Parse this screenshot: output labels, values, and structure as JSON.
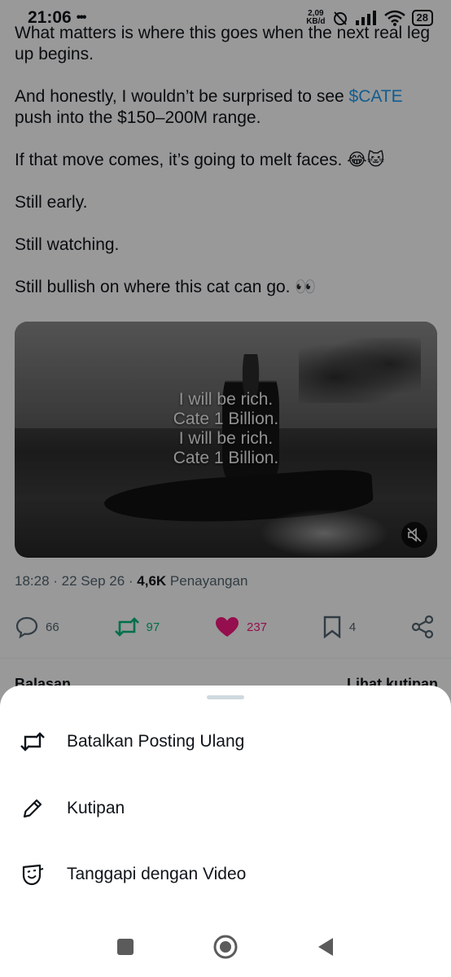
{
  "status_bar": {
    "time": "21:06",
    "notification_dots": "•••",
    "net_speed_value": "2,09",
    "net_speed_unit": "KB/d",
    "battery": "28"
  },
  "tweet": {
    "paragraphs": {
      "p1": "What matters is where this goes when the next real leg up begins.",
      "p2_before": "And honestly, I wouldn’t be surprised to see ",
      "p2_cashtag": "$CATE",
      "p2_after": " push into the $150–200M range.",
      "p3": "If that move comes, it’s going to melt faces. 😂🐱",
      "p4": "Still early.",
      "p5": "Still watching.",
      "p6": "Still bullish on where this cat can go. 👀"
    },
    "media_caption": {
      "line1": "I will be rich.",
      "line2": "Cate 1 Billion.",
      "line3": "I will be rich.",
      "line4": "Cate 1 Billion."
    },
    "meta": {
      "time": "18:28",
      "sep1": " · ",
      "date": "22 Sep 26",
      "sep2": " · ",
      "views_count": "4,6K",
      "views_label": " Penayangan"
    },
    "actions": {
      "replies": "66",
      "reposts": "97",
      "likes": "237",
      "bookmarks": "4"
    },
    "below_left": "Balasan",
    "below_right": "Lihat kutipan"
  },
  "sheet": {
    "items": [
      {
        "label": "Batalkan Posting Ulang",
        "icon": "repost-icon"
      },
      {
        "label": "Kutipan",
        "icon": "pencil-icon"
      },
      {
        "label": "Tanggapi dengan Video",
        "icon": "video-reply-icon"
      }
    ]
  },
  "colors": {
    "accent": "#1d9bf0",
    "repost": "#00ba7c",
    "like": "#f91880",
    "text": "#0f1419",
    "muted": "#536471"
  }
}
